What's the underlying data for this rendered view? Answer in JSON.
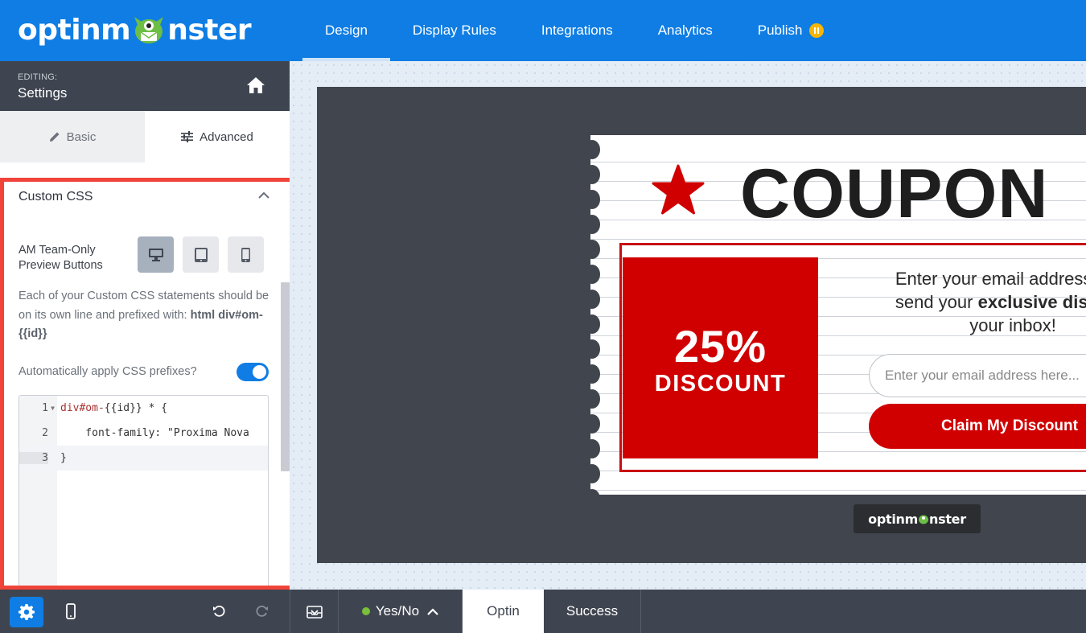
{
  "app": {
    "logo_text_left": "optinm",
    "logo_text_right": "nster",
    "nav": [
      {
        "label": "Design",
        "active": true
      },
      {
        "label": "Display Rules"
      },
      {
        "label": "Integrations"
      },
      {
        "label": "Analytics"
      },
      {
        "label": "Publish",
        "icon": "pause-status-icon"
      }
    ],
    "accent_color": "#0f7de3"
  },
  "sidebar": {
    "editing_label": "EDITING:",
    "editing_title": "Settings",
    "tabs": [
      {
        "label": "Basic",
        "icon": "pencil-icon"
      },
      {
        "label": "Advanced",
        "icon": "sliders-icon",
        "active": true
      }
    ],
    "section_title": "Custom CSS",
    "preview_label": "AM Team-Only Preview Buttons",
    "preview_buttons": [
      "desktop-icon",
      "tablet-icon",
      "mobile-icon"
    ],
    "description_prefix": "Each of your Custom CSS statements should be on its own line and prefixed with: ",
    "description_code": "html div#om-{{id}}",
    "auto_prefix_label": "Automatically apply CSS prefixes?",
    "auto_prefix_enabled": true,
    "code_lines": [
      {
        "num": "1",
        "selector": "div",
        "id": "#om-",
        "rest": "{{id}} * {"
      },
      {
        "num": "2",
        "text": "    font-family: \"Proxima Nova"
      },
      {
        "num": "3",
        "text": "}"
      }
    ]
  },
  "canvas": {
    "coupon_title": "COUPON",
    "discount_pct": "25%",
    "discount_word": "DISCOUNT",
    "offer_line1": "Enter your email address belo",
    "offer_line2_pre": "send your ",
    "offer_line2_bold": "exclusive discoun",
    "offer_line3": "your inbox!",
    "email_placeholder": "Enter your email address here...",
    "claim_button": "Claim My Discount",
    "badge_left": "optinm",
    "badge_right": "nster",
    "brand_red": "#d00000"
  },
  "bottombar": {
    "view_label": "Yes/No",
    "optin_tab": "Optin",
    "success_tab": "Success"
  }
}
